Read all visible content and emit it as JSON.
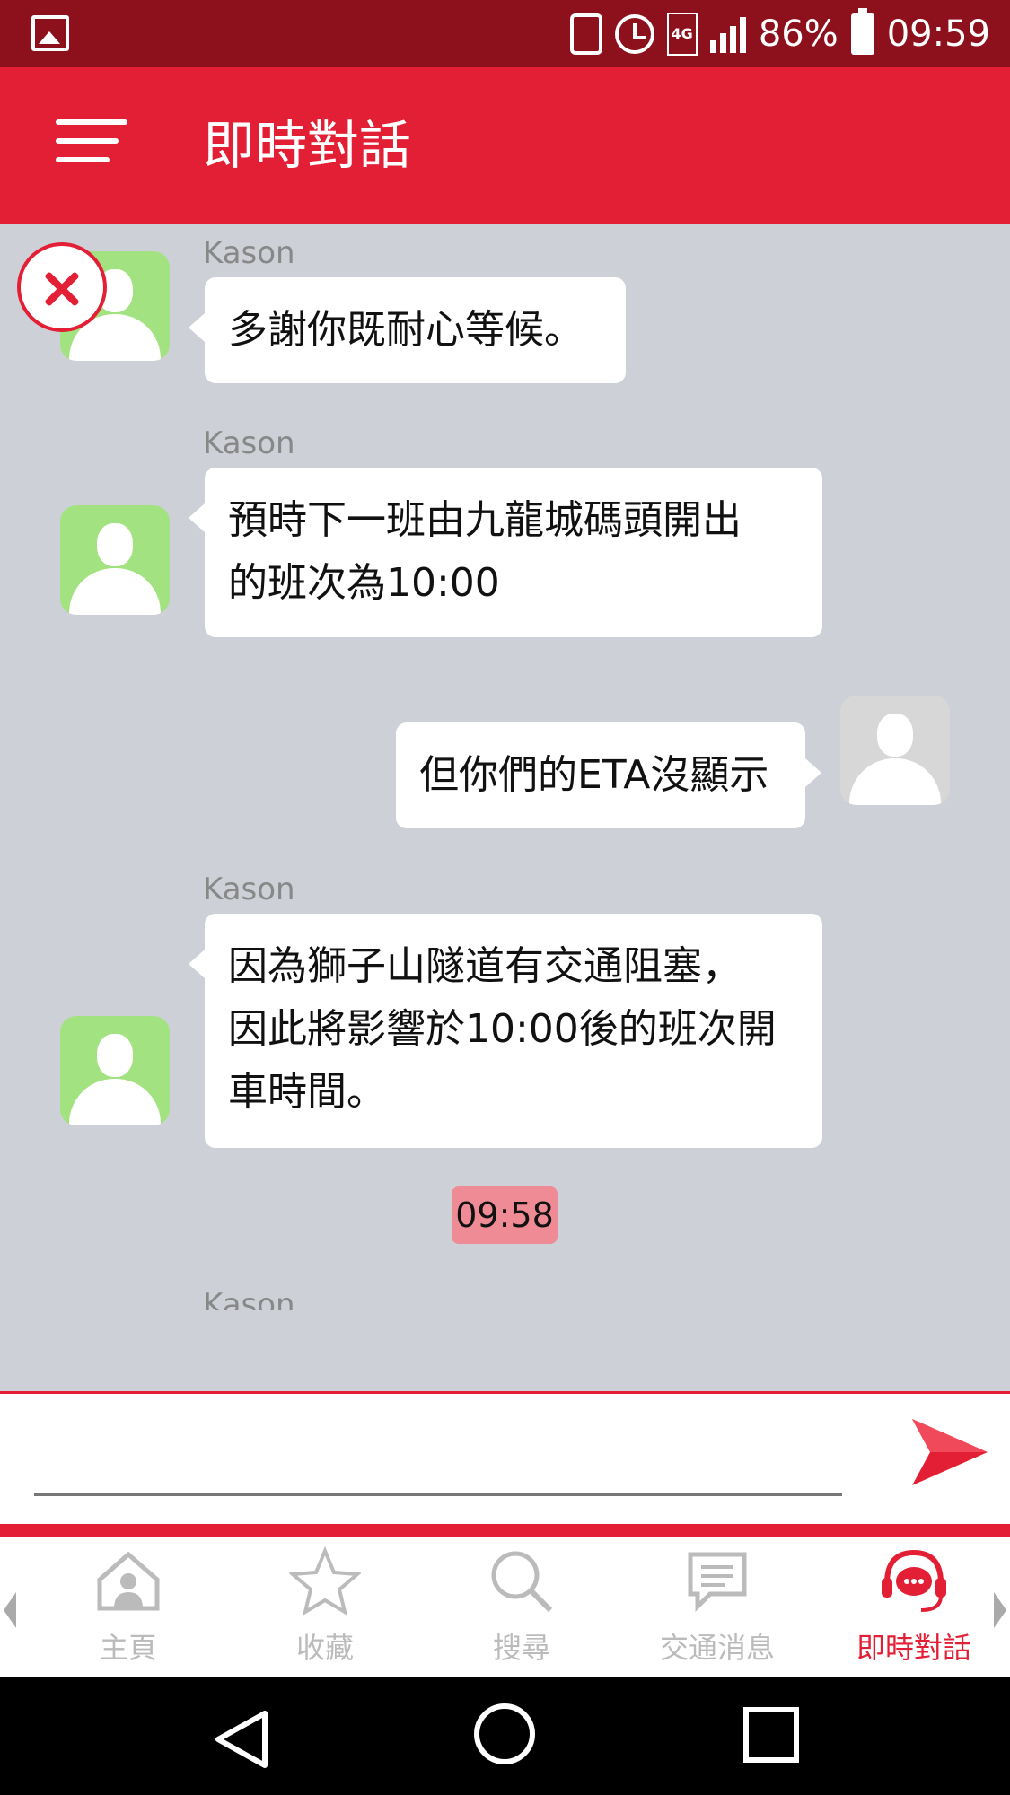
{
  "status_bar": {
    "battery": "86%",
    "time": "09:59",
    "network": "4G"
  },
  "app_bar": {
    "title": "即時對話"
  },
  "chat": {
    "messages": [
      {
        "sender": "Kason",
        "lines": [
          "多謝你既耐心等候。"
        ]
      },
      {
        "sender": "Kason",
        "lines": [
          "預時下一班由九龍城碼頭開出",
          "的班次為10:00"
        ]
      },
      {
        "sender": "",
        "lines": [
          "但你們的ETA沒顯示"
        ]
      },
      {
        "sender": "Kason",
        "lines": [
          "因為獅子山隧道有交通阻塞，",
          "因此將影響於10:00後的班次開",
          "車時間。"
        ]
      }
    ],
    "timestamp": "09:58",
    "partial_sender": "Kason"
  },
  "input": {
    "value": "",
    "placeholder": ""
  },
  "bottom_nav": {
    "items": [
      {
        "label": "主頁",
        "icon": "home-icon"
      },
      {
        "label": "收藏",
        "icon": "star-icon"
      },
      {
        "label": "搜尋",
        "icon": "search-icon"
      },
      {
        "label": "交通消息",
        "icon": "message-icon"
      },
      {
        "label": "即時對話",
        "icon": "chat-support-icon",
        "active": true
      }
    ]
  },
  "colors": {
    "accent": "#e31f35",
    "status_bar": "#8c111d",
    "chat_bg": "#cdd1d7",
    "agent_avatar": "#a3e281",
    "timestamp_bg": "#ef8b95"
  }
}
